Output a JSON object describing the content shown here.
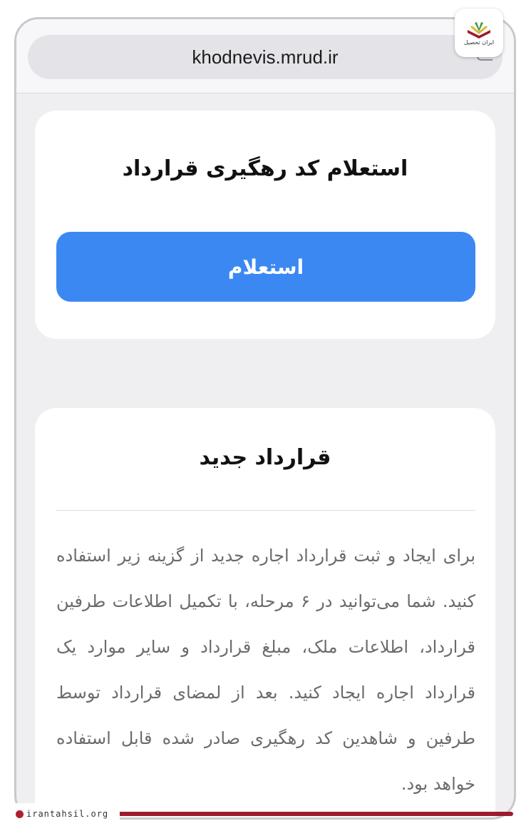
{
  "browser": {
    "url": "khodnevis.mrud.ir"
  },
  "tracking_card": {
    "title": "استعلام کد رهگیری قرارداد",
    "button_label": "استعلام"
  },
  "new_contract_card": {
    "title": "قرارداد جدید",
    "description": "برای ایجاد و ثبت قرارداد اجاره جدید از گزینه زیر استفاده کنید. شما می‌توانید در ۶ مرحله، با تکمیل اطلاعات طرفین قرارداد، اطلاعات ملک، مبلغ قرارداد و سایر موارد یک قرارداد اجاره ایجاد کنید. بعد از لمضای قرارداد توسط طرفین و شاهدین کد رهگیری صادر شده قابل استفاده خواهد بود."
  },
  "watermark": {
    "logo_text": "ایران تحصیل",
    "site": "irantahsil.org"
  },
  "colors": {
    "primary_button": "#3b88f2",
    "brand_red": "#9b1c2e",
    "background": "#efeff2"
  }
}
